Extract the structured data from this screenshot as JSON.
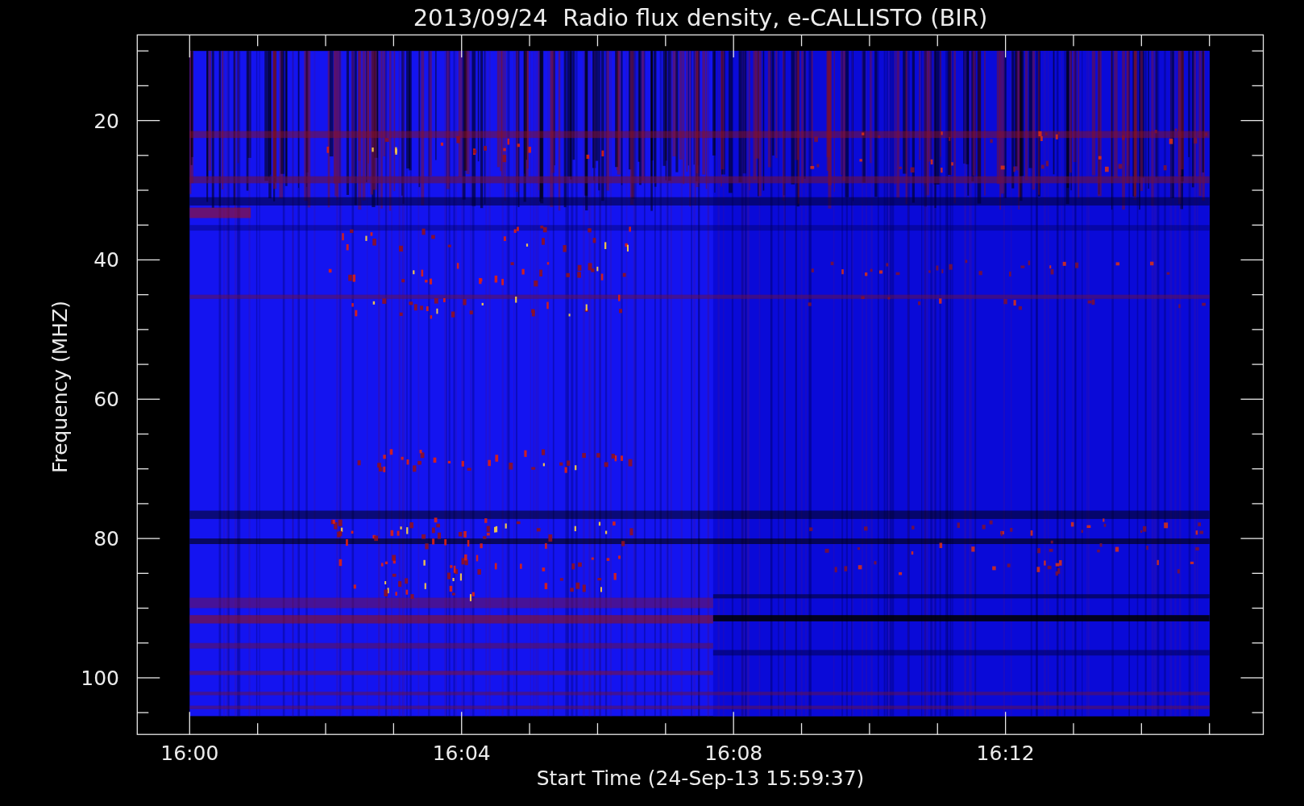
{
  "title": "2013/09/24  Radio flux density, e-CALLISTO (BIR)",
  "plot": {
    "xlabel": "Start Time (24-Sep-13 15:59:37)",
    "ylabel": "Frequency (MHZ)",
    "xticks": [
      "16:00",
      "16:04",
      "16:08",
      "16:12"
    ],
    "yticks": [
      "20",
      "40",
      "60",
      "80",
      "100"
    ]
  }
}
